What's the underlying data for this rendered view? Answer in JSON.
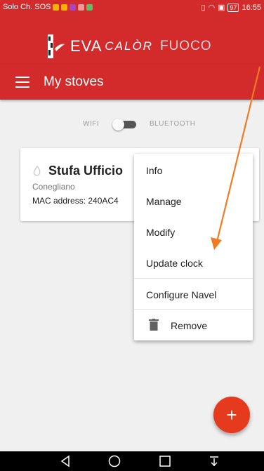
{
  "statusbar": {
    "carrier": "Solo Ch. SOS",
    "battery": "97",
    "time": "16:55"
  },
  "logo": {
    "part1": "EVA",
    "part2": "CALÒR",
    "part3": "FUOCO"
  },
  "appbar": {
    "title": "My stoves"
  },
  "connection": {
    "wifi_label": "WIFI",
    "bluetooth_label": "BLUETOOTH",
    "selected": "bluetooth"
  },
  "stove": {
    "name": "Stufa Ufficio",
    "city": "Conegliano",
    "mac": "MAC address: 240AC4"
  },
  "menu": {
    "items": [
      {
        "label": "Info"
      },
      {
        "label": "Manage"
      },
      {
        "label": "Modify"
      },
      {
        "label": "Update clock"
      },
      {
        "label": "Configure Navel"
      },
      {
        "label": "Remove",
        "icon": "trash-icon"
      }
    ]
  },
  "fab": {
    "label": "+"
  },
  "colors": {
    "primary": "#d32a2b",
    "fab": "#e63a1f",
    "annotation_arrow": "#ef7b22"
  }
}
